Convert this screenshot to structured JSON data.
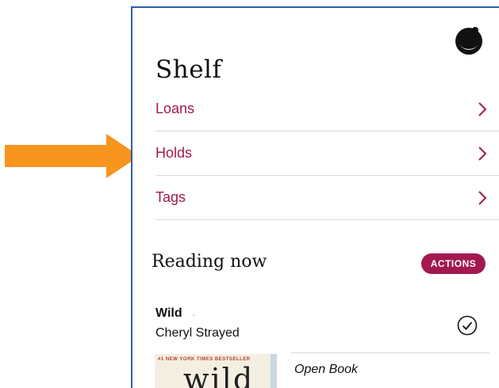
{
  "shelf": {
    "title": "Shelf",
    "nav": [
      {
        "label": "Loans"
      },
      {
        "label": "Holds"
      },
      {
        "label": "Tags"
      }
    ]
  },
  "reading_now": {
    "title": "Reading now",
    "actions_label": "ACTIONS",
    "book": {
      "title": "Wild",
      "separator": "·",
      "author": "Cheryl Strayed",
      "cover_tag": "#1 NEW YORK TIMES BESTSELLER",
      "cover_title": "wild",
      "open_label": "Open Book"
    }
  },
  "colors": {
    "accent": "#a3194f",
    "arrow": "#f7941d",
    "panel_border": "#2b5fa8"
  },
  "icons": {
    "avatar": "avatar-icon",
    "chevron": "chevron-right-icon",
    "check": "check-circle-icon",
    "pointer": "arrow-right-icon"
  }
}
